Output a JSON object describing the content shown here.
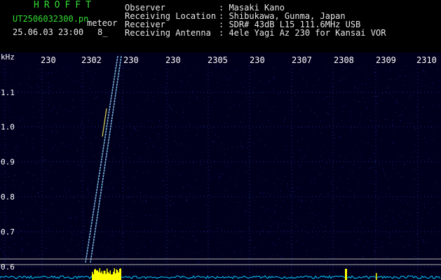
{
  "app": {
    "title": "HROFFT",
    "filename": "UT2506032300.pn",
    "mode": "meteor",
    "datetime": "25.06.03 23:00",
    "counter": "8_"
  },
  "info": {
    "labels": [
      "Observer",
      "Receiving Location",
      "Receiver",
      "Receiving Antenna"
    ],
    "values": [
      ": Masaki Kano",
      ": Shibukawa, Gunma, Japan",
      ": SDR# 43dB L15 111.6MHz USB",
      ": 4ele Yagi Az 230 for Kansai VOR"
    ]
  },
  "spectrogram": {
    "unit_label": "kHz",
    "time_labels": [
      "230",
      "2302",
      "230",
      "230",
      "2305",
      "230",
      "2307",
      "2308",
      "2309",
      "2310"
    ],
    "freq_labels": [
      "1.1",
      "1.0",
      "0.9",
      "0.8",
      "0.7",
      "0.6"
    ],
    "colors": {
      "background": "#00001c",
      "noise": "#1a2a9a",
      "trail": "#8fd0ff",
      "spectrum": "#00c8ff",
      "burst": "#ffff00",
      "reference_line": "#b0b0b0"
    }
  }
}
